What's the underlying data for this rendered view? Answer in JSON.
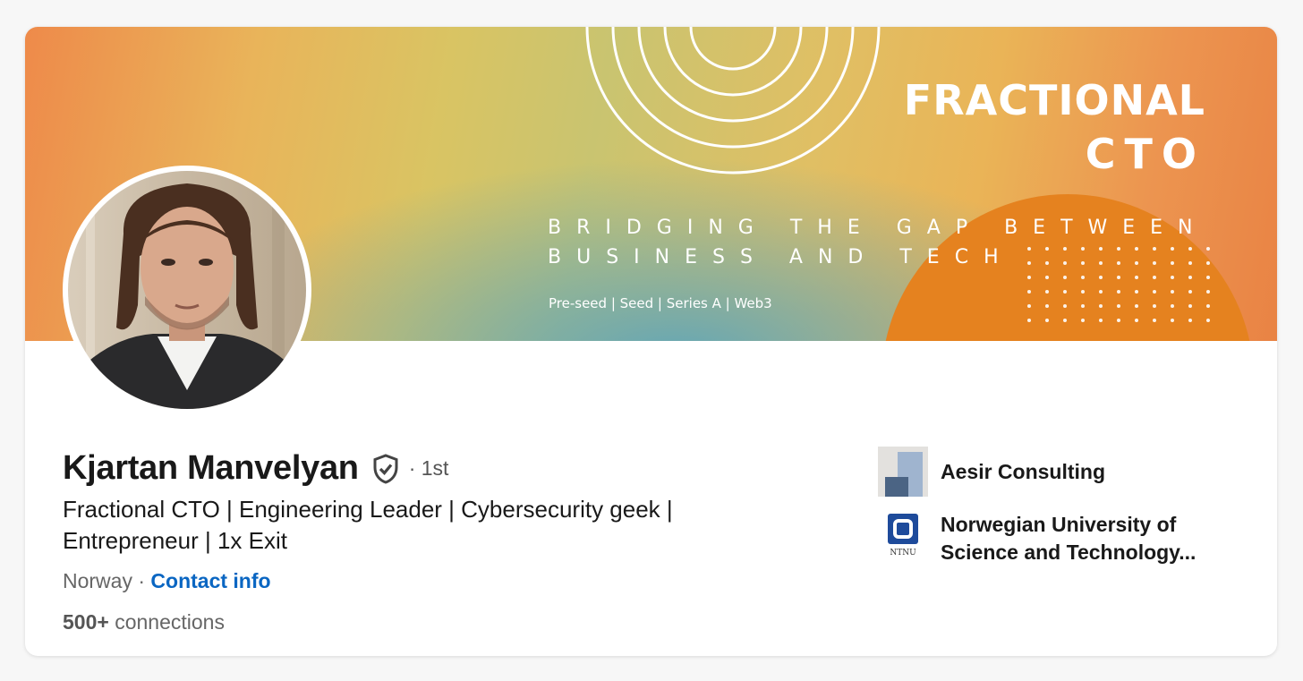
{
  "banner": {
    "title_line1": "FRACTIONAL",
    "title_line2": "CTO",
    "tagline_line1": "BRIDGING THE GAP BETWEEN",
    "tagline_line2": "BUSINESS AND TECH",
    "stages": "Pre-seed | Seed | Series A | Web3"
  },
  "profile": {
    "name": "Kjartan Manvelyan",
    "verified_icon": "verified-shield-icon",
    "degree": "· 1st",
    "headline": "Fractional CTO | Engineering Leader | Cybersecurity geek | Entrepreneur | 1x Exit",
    "location": "Norway",
    "separator": " · ",
    "contact_label": "Contact info",
    "connections_count": "500+",
    "connections_label": " connections"
  },
  "organizations": [
    {
      "name": "Aesir Consulting",
      "logo": "aesir-logo"
    },
    {
      "name": "Norwegian University of Science and Technology...",
      "logo": "ntnu-logo",
      "logo_text": "NTNU"
    }
  ],
  "colors": {
    "accent_link": "#0a66c2",
    "banner_orange": "#e5821f",
    "text_primary": "#191919",
    "text_secondary": "#666666"
  }
}
